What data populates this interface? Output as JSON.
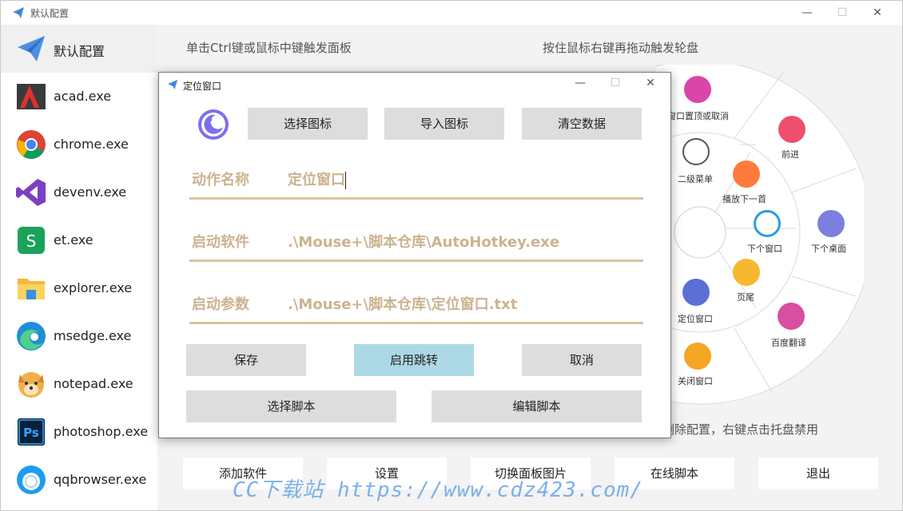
{
  "window": {
    "title": "默认配置",
    "minimize_glyph": "—",
    "maximize_glyph": "☐",
    "close_glyph": "✕"
  },
  "sidebar": {
    "items": [
      {
        "label": "默认配置",
        "icon": "paper-plane-icon"
      },
      {
        "label": "acad.exe",
        "icon": "autocad-icon"
      },
      {
        "label": "chrome.exe",
        "icon": "chrome-icon"
      },
      {
        "label": "devenv.exe",
        "icon": "visual-studio-icon"
      },
      {
        "label": "et.exe",
        "icon": "wps-et-icon"
      },
      {
        "label": "explorer.exe",
        "icon": "folder-icon"
      },
      {
        "label": "msedge.exe",
        "icon": "edge-icon"
      },
      {
        "label": "notepad.exe",
        "icon": "dog-icon"
      },
      {
        "label": "photoshop.exe",
        "icon": "photoshop-icon"
      },
      {
        "label": "qqbrowser.exe",
        "icon": "qqbrowser-icon"
      }
    ]
  },
  "hints": {
    "left": "单击Ctrl键或鼠标中键触发面板",
    "right": "按住鼠标右键再拖动触发轮盘",
    "bottom": "删除配置，右键点击托盘禁用"
  },
  "wheel": {
    "items": [
      {
        "label": "窗口置顶或取消"
      },
      {
        "label": "前进"
      },
      {
        "label": "二级菜单"
      },
      {
        "label": "播放下一首"
      },
      {
        "label": "下个窗口"
      },
      {
        "label": "下个桌面"
      },
      {
        "label": "页尾"
      },
      {
        "label": "定位窗口"
      },
      {
        "label": "百度翻译"
      },
      {
        "label": "关闭窗口"
      }
    ]
  },
  "bottom_buttons": {
    "add": "添加软件",
    "settings": "设置",
    "switch_panel": "切换面板图片",
    "online_script": "在线脚本",
    "exit": "退出"
  },
  "watermark": "CC下载站 https://www.cdz423.com/",
  "dialog": {
    "title": "定位窗口",
    "btn_select_icon": "选择图标",
    "btn_import_icon": "导入图标",
    "btn_clear": "清空数据",
    "action_name_label": "动作名称",
    "action_name_value": "定位窗口",
    "launch_app_label": "启动软件",
    "launch_app_value": ".\\Mouse+\\脚本仓库\\AutoHotkey.exe",
    "launch_args_label": "启动参数",
    "launch_args_value": ".\\Mouse+\\脚本仓库\\定位窗口.txt",
    "btn_save": "保存",
    "btn_enable_jump": "启用跳转",
    "btn_cancel": "取消",
    "btn_select_script": "选择脚本",
    "btn_edit_script": "编辑脚本"
  },
  "colors": {
    "accent": "#add8e6",
    "field_text": "#cbb38f",
    "underline": "#d6c4a4",
    "button": "#dddddd"
  }
}
